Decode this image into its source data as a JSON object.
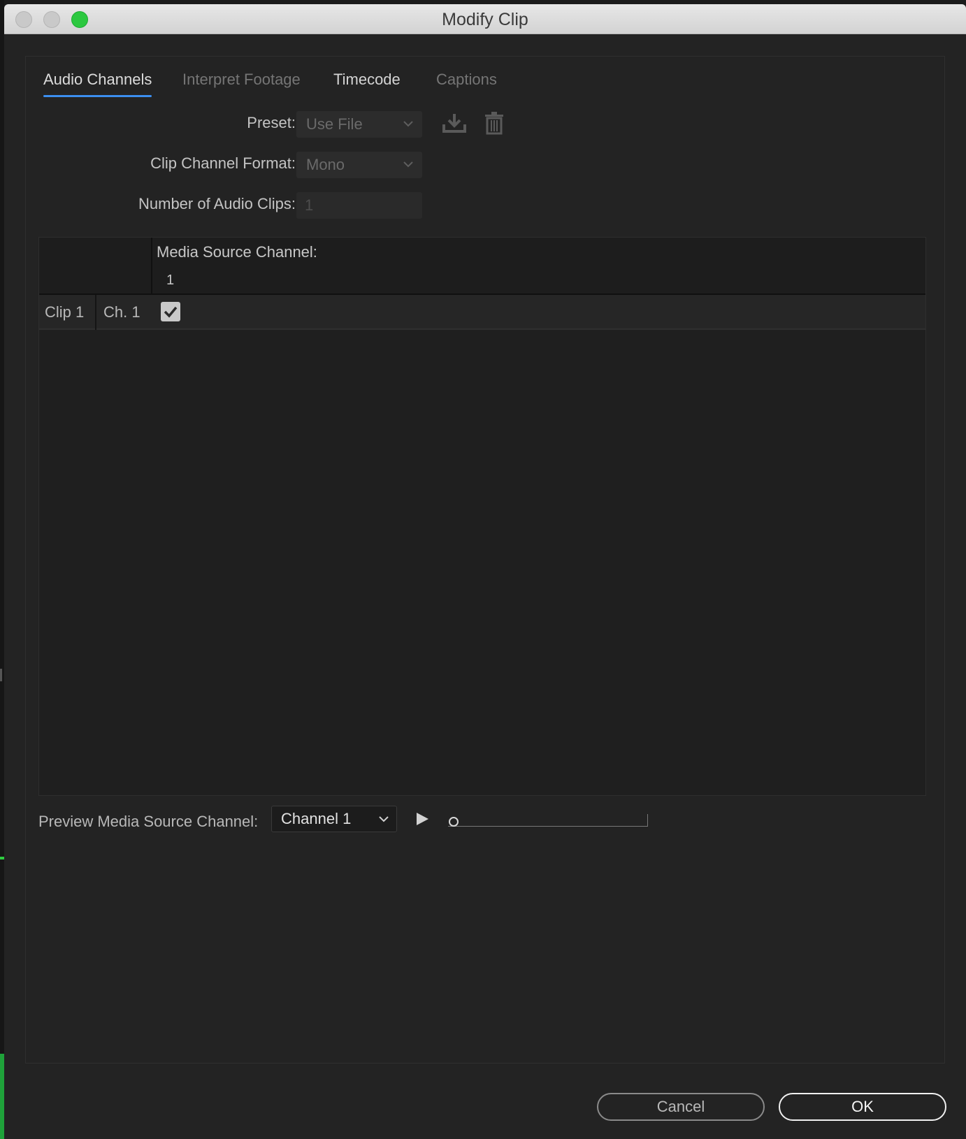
{
  "window": {
    "title": "Modify Clip"
  },
  "tabs": [
    {
      "label": "Audio Channels",
      "active": true
    },
    {
      "label": "Interpret Footage",
      "active": false
    },
    {
      "label": "Timecode",
      "active": false
    },
    {
      "label": "Captions",
      "active": false
    }
  ],
  "form": {
    "preset_label": "Preset:",
    "preset_value": "Use File",
    "channel_format_label": "Clip Channel Format:",
    "channel_format_value": "Mono",
    "num_clips_label": "Number of Audio Clips:",
    "num_clips_value": "1"
  },
  "icons": {
    "save_preset": "download-icon",
    "delete_preset": "trash-icon"
  },
  "grid": {
    "header_label": "Media Source Channel:",
    "channel_numbers": [
      "1"
    ],
    "rows": [
      {
        "clip": "Clip 1",
        "channel": "Ch. 1",
        "checked": true
      }
    ]
  },
  "preview": {
    "label": "Preview Media Source Channel:",
    "channel_value": "Channel 1",
    "progress": 0
  },
  "buttons": {
    "cancel": "Cancel",
    "ok": "OK"
  },
  "colors": {
    "accent": "#3c8ff0",
    "background": "#232323",
    "maximize": "#2cc840"
  }
}
